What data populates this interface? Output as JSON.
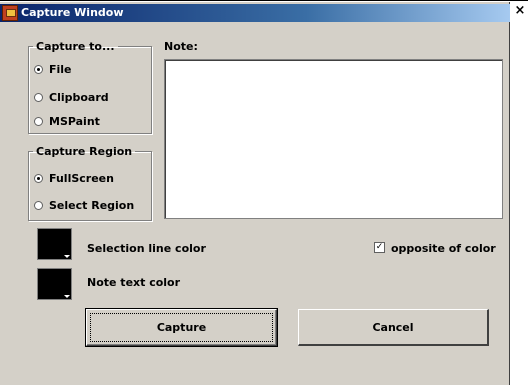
{
  "window": {
    "title": "Capture Window",
    "close_glyph": "×",
    "icon": "app-icon"
  },
  "capture_to": {
    "legend": "Capture to...",
    "options": [
      {
        "label": "File",
        "selected": true
      },
      {
        "label": "Clipboard",
        "selected": false
      },
      {
        "label": "MSPaint",
        "selected": false
      }
    ]
  },
  "capture_region": {
    "legend": "Capture Region",
    "options": [
      {
        "label": "FullScreen",
        "selected": true
      },
      {
        "label": "Select Region",
        "selected": false
      }
    ]
  },
  "note": {
    "label": "Note:",
    "value": ""
  },
  "selection_color": {
    "label": "Selection line color",
    "color": "#000000"
  },
  "note_text_color": {
    "label": "Note text color",
    "color": "#000000"
  },
  "opposite": {
    "label": "opposite of color",
    "checked": true,
    "check_glyph": "✓"
  },
  "buttons": {
    "capture": "Capture",
    "cancel": "Cancel"
  }
}
